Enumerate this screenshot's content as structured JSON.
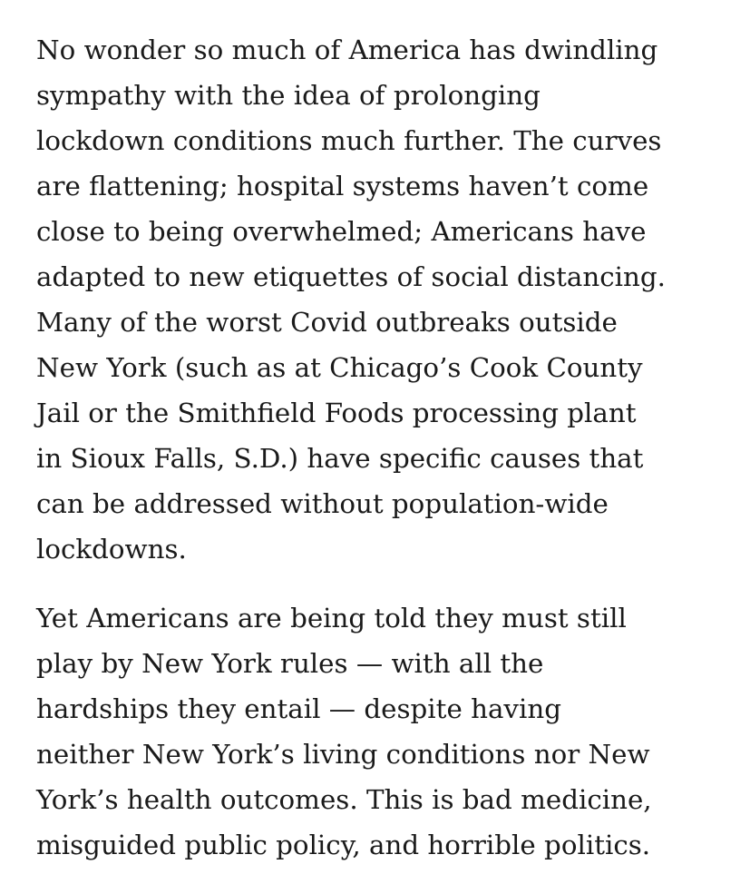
{
  "article": {
    "paragraphs": [
      {
        "lines": [
          "No wonder so much of America has dwindling",
          "sympathy with the idea of prolonging",
          "lockdown conditions much further. The curves",
          "are flattening; hospital systems haven’t come",
          "close to being overwhelmed; Americans have",
          "adapted to new etiquettes of social distancing.",
          "Many of the worst Covid outbreaks outside",
          "New York (such as at Chicago’s Cook County",
          "Jail or the Smithfield Foods processing plant",
          "in Sioux Falls, S.D.) have specific causes that",
          "can be addressed without population-wide",
          "lockdowns."
        ]
      },
      {
        "lines": [
          "Yet Americans are being told they must still",
          "play by New York rules — with all the",
          "hardships they entail — despite having",
          "neither New York’s living conditions nor New",
          "York’s health outcomes. This is bad medicine,",
          "misguided public policy, and horrible politics."
        ]
      }
    ]
  }
}
